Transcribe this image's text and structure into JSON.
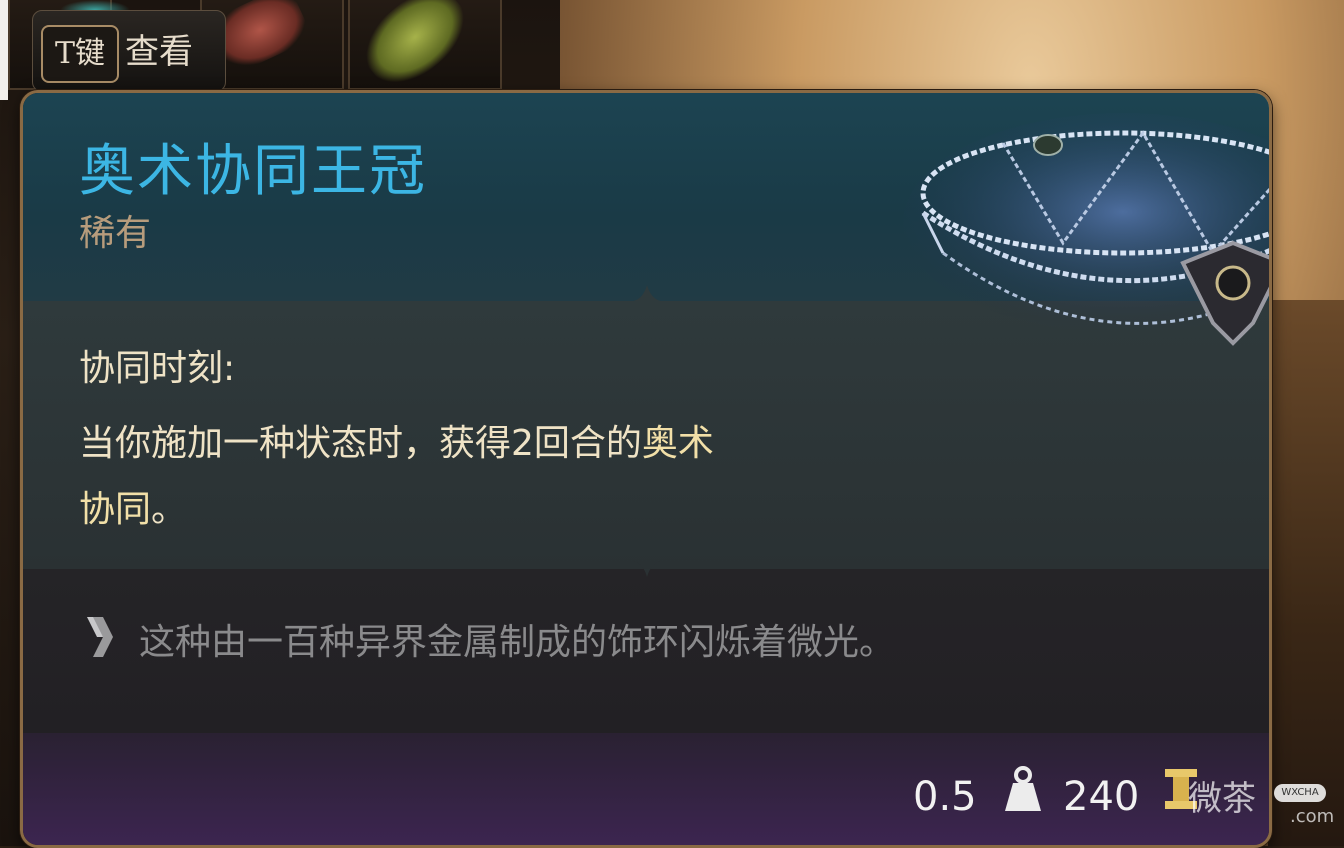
{
  "inventory": {
    "tooltip_key": "T键",
    "tooltip_key_label": "查看"
  },
  "item": {
    "name": "奥术协同王冠",
    "rarity": "稀有",
    "passive": {
      "name": "协同时刻:",
      "text_before": "当你施加一种状态时，获得2回合的",
      "text_highlight": "奥术",
      "text_line2_highlight": "协同",
      "text_end": "。"
    },
    "description": "这种由一百种异界金属制成的饰环闪烁着微光。",
    "weight": "0.5",
    "price": "240"
  },
  "watermark": {
    "text": "微茶",
    "badge": "WXCHA",
    "domain": ".com"
  },
  "colors": {
    "title": "#3cb6e4",
    "rarity": "#b79c7c",
    "body_text": "#efe3c6",
    "description": "#8a8a8c"
  },
  "icons": {
    "description_icon": "lore-chevron-icon",
    "weight_icon": "weight-icon",
    "gold_icon": "gold-coin-icon"
  }
}
